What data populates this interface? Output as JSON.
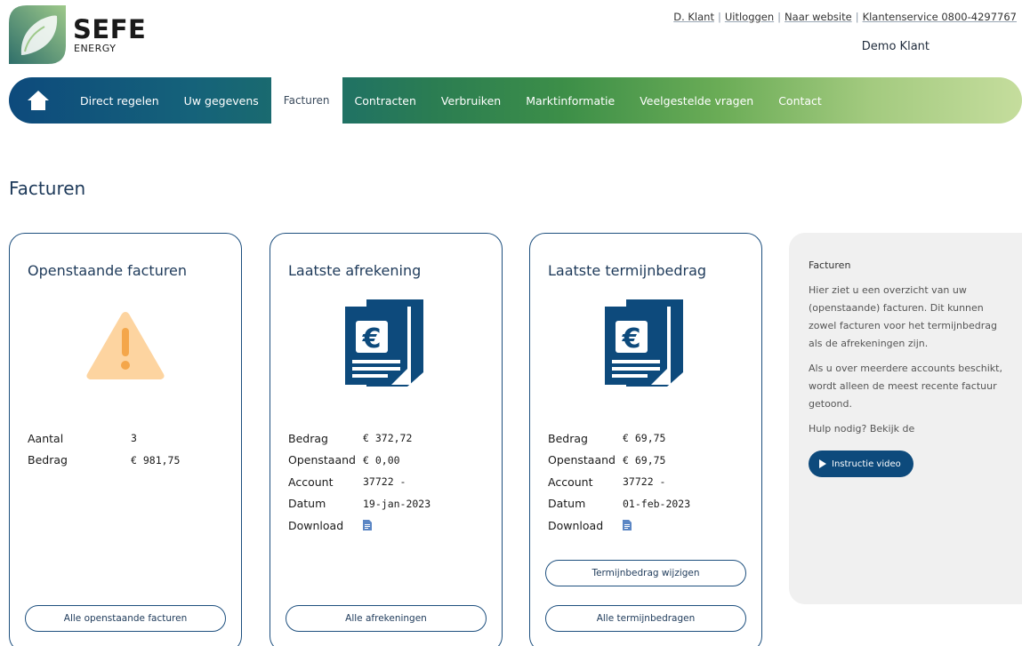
{
  "brand": {
    "name": "SEFE",
    "sub": "ENERGY"
  },
  "toplinks": {
    "user": "D. Klant",
    "logout": "Uitloggen",
    "website": "Naar website",
    "service": "Klantenservice 0800-4297767"
  },
  "username": "Demo Klant",
  "nav": {
    "items": [
      {
        "label": "Direct regelen"
      },
      {
        "label": "Uw gegevens"
      },
      {
        "label": "Facturen"
      },
      {
        "label": "Contracten"
      },
      {
        "label": "Verbruiken"
      },
      {
        "label": "Marktinformatie"
      },
      {
        "label": "Veelgestelde vragen"
      },
      {
        "label": "Contact"
      }
    ]
  },
  "page_title": "Facturen",
  "cards": {
    "open": {
      "title": "Openstaande facturen",
      "rows": [
        {
          "label": "Aantal",
          "value": "3"
        },
        {
          "label": "Bedrag",
          "value": "€ 981,75"
        }
      ],
      "button": "Alle openstaande facturen"
    },
    "settlement": {
      "title": "Laatste afrekening",
      "rows": [
        {
          "label": "Bedrag",
          "value": "€ 372,72"
        },
        {
          "label": "Openstaand",
          "value": "€ 0,00"
        },
        {
          "label": "Account",
          "value": "37722 -"
        },
        {
          "label": "Datum",
          "value": "19-jan-2023"
        },
        {
          "label": "Download"
        }
      ],
      "button": "Alle afrekeningen"
    },
    "instalment": {
      "title": "Laatste termijnbedrag",
      "rows": [
        {
          "label": "Bedrag",
          "value": "€ 69,75"
        },
        {
          "label": "Openstaand",
          "value": "€ 69,75"
        },
        {
          "label": "Account",
          "value": "37722 -"
        },
        {
          "label": "Datum",
          "value": "01-feb-2023"
        },
        {
          "label": "Download"
        }
      ],
      "button_change": "Termijnbedrag wijzigen",
      "button": "Alle termijnbedragen"
    }
  },
  "aside": {
    "title": "Facturen",
    "p1": "Hier ziet u een overzicht van uw (openstaande) facturen. Dit kunnen zowel facturen voor het termijnbedrag als de afrekeningen zijn.",
    "p2": "Als u over meerdere accounts beschikt, wordt alleen de meest recente factuur getoond.",
    "p3": "Hulp nodig? Bekijk de",
    "video_button": "Instructie video"
  },
  "colors": {
    "primary": "#0d4a7c",
    "card_border": "#1d4f7e",
    "warning": "#fdd4a0",
    "warning_mark": "#f4a64a"
  },
  "icons": {
    "home": "home-icon",
    "warning": "warning-icon",
    "invoice": "euro-invoice-icon",
    "download": "document-icon",
    "play": "play-icon"
  }
}
